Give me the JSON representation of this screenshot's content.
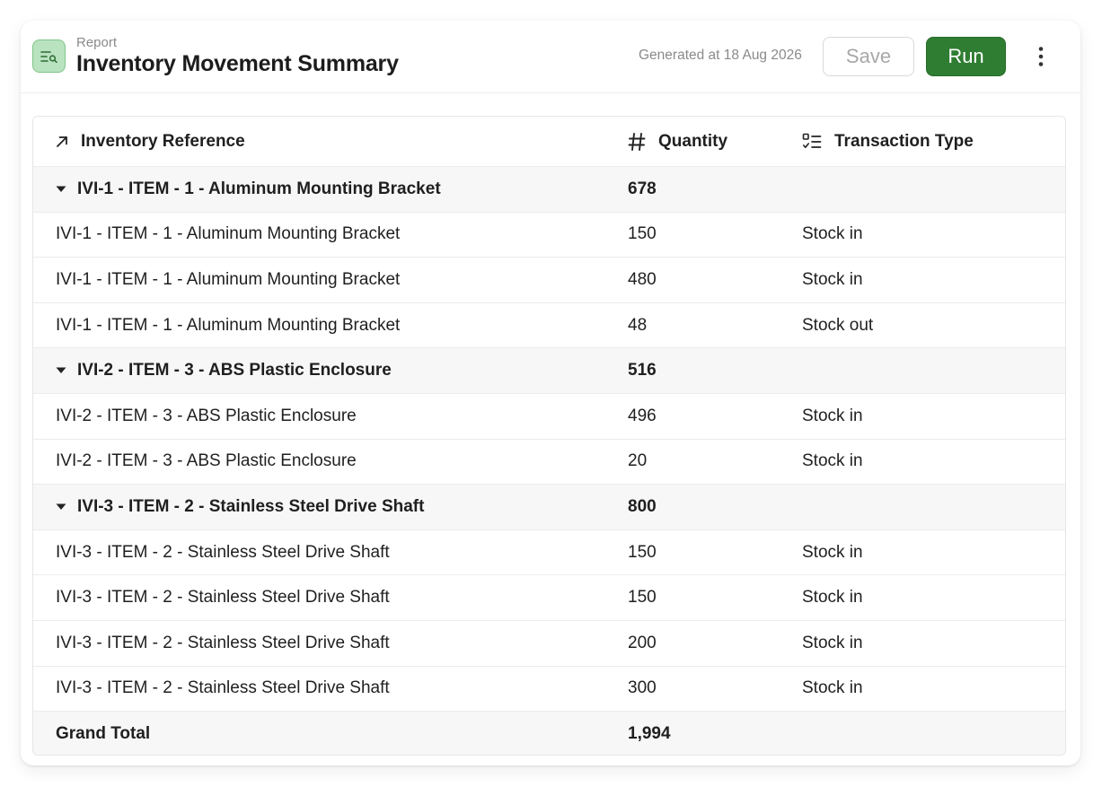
{
  "header": {
    "eyebrow": "Report",
    "title": "Inventory Movement Summary",
    "generated": "Generated at 18 Aug 2026",
    "save_label": "Save",
    "run_label": "Run"
  },
  "colors": {
    "accent": "#2f7d32",
    "icon_bg": "#b9e2bf",
    "group_bg": "#f7f7f7"
  },
  "table": {
    "columns": [
      {
        "label": "Inventory Reference",
        "icon": "arrow-up-right-icon"
      },
      {
        "label": "Quantity",
        "icon": "hash-icon"
      },
      {
        "label": "Transaction Type",
        "icon": "list-checks-icon"
      }
    ],
    "groups": [
      {
        "label": "IVI-1 - ITEM - 1 - Aluminum Mounting Bracket",
        "total": "678",
        "rows": [
          {
            "ref": "IVI-1 - ITEM - 1 - Aluminum Mounting Bracket",
            "qty": "150",
            "type": "Stock in"
          },
          {
            "ref": "IVI-1 - ITEM - 1 - Aluminum Mounting Bracket",
            "qty": "480",
            "type": "Stock in"
          },
          {
            "ref": "IVI-1 - ITEM - 1 - Aluminum Mounting Bracket",
            "qty": "48",
            "type": "Stock out"
          }
        ]
      },
      {
        "label": "IVI-2 - ITEM - 3 - ABS Plastic Enclosure",
        "total": "516",
        "rows": [
          {
            "ref": "IVI-2 - ITEM - 3 - ABS Plastic Enclosure",
            "qty": "496",
            "type": "Stock in"
          },
          {
            "ref": "IVI-2 - ITEM - 3 - ABS Plastic Enclosure",
            "qty": "20",
            "type": "Stock in"
          }
        ]
      },
      {
        "label": "IVI-3 - ITEM - 2 - Stainless Steel Drive Shaft",
        "total": "800",
        "rows": [
          {
            "ref": "IVI-3 - ITEM - 2 - Stainless Steel Drive Shaft",
            "qty": "150",
            "type": "Stock in"
          },
          {
            "ref": "IVI-3 - ITEM - 2 - Stainless Steel Drive Shaft",
            "qty": "150",
            "type": "Stock in"
          },
          {
            "ref": "IVI-3 - ITEM - 2 - Stainless Steel Drive Shaft",
            "qty": "200",
            "type": "Stock in"
          },
          {
            "ref": "IVI-3 - ITEM - 2 - Stainless Steel Drive Shaft",
            "qty": "300",
            "type": "Stock in"
          }
        ]
      }
    ],
    "grand_total_label": "Grand Total",
    "grand_total": "1,994"
  }
}
